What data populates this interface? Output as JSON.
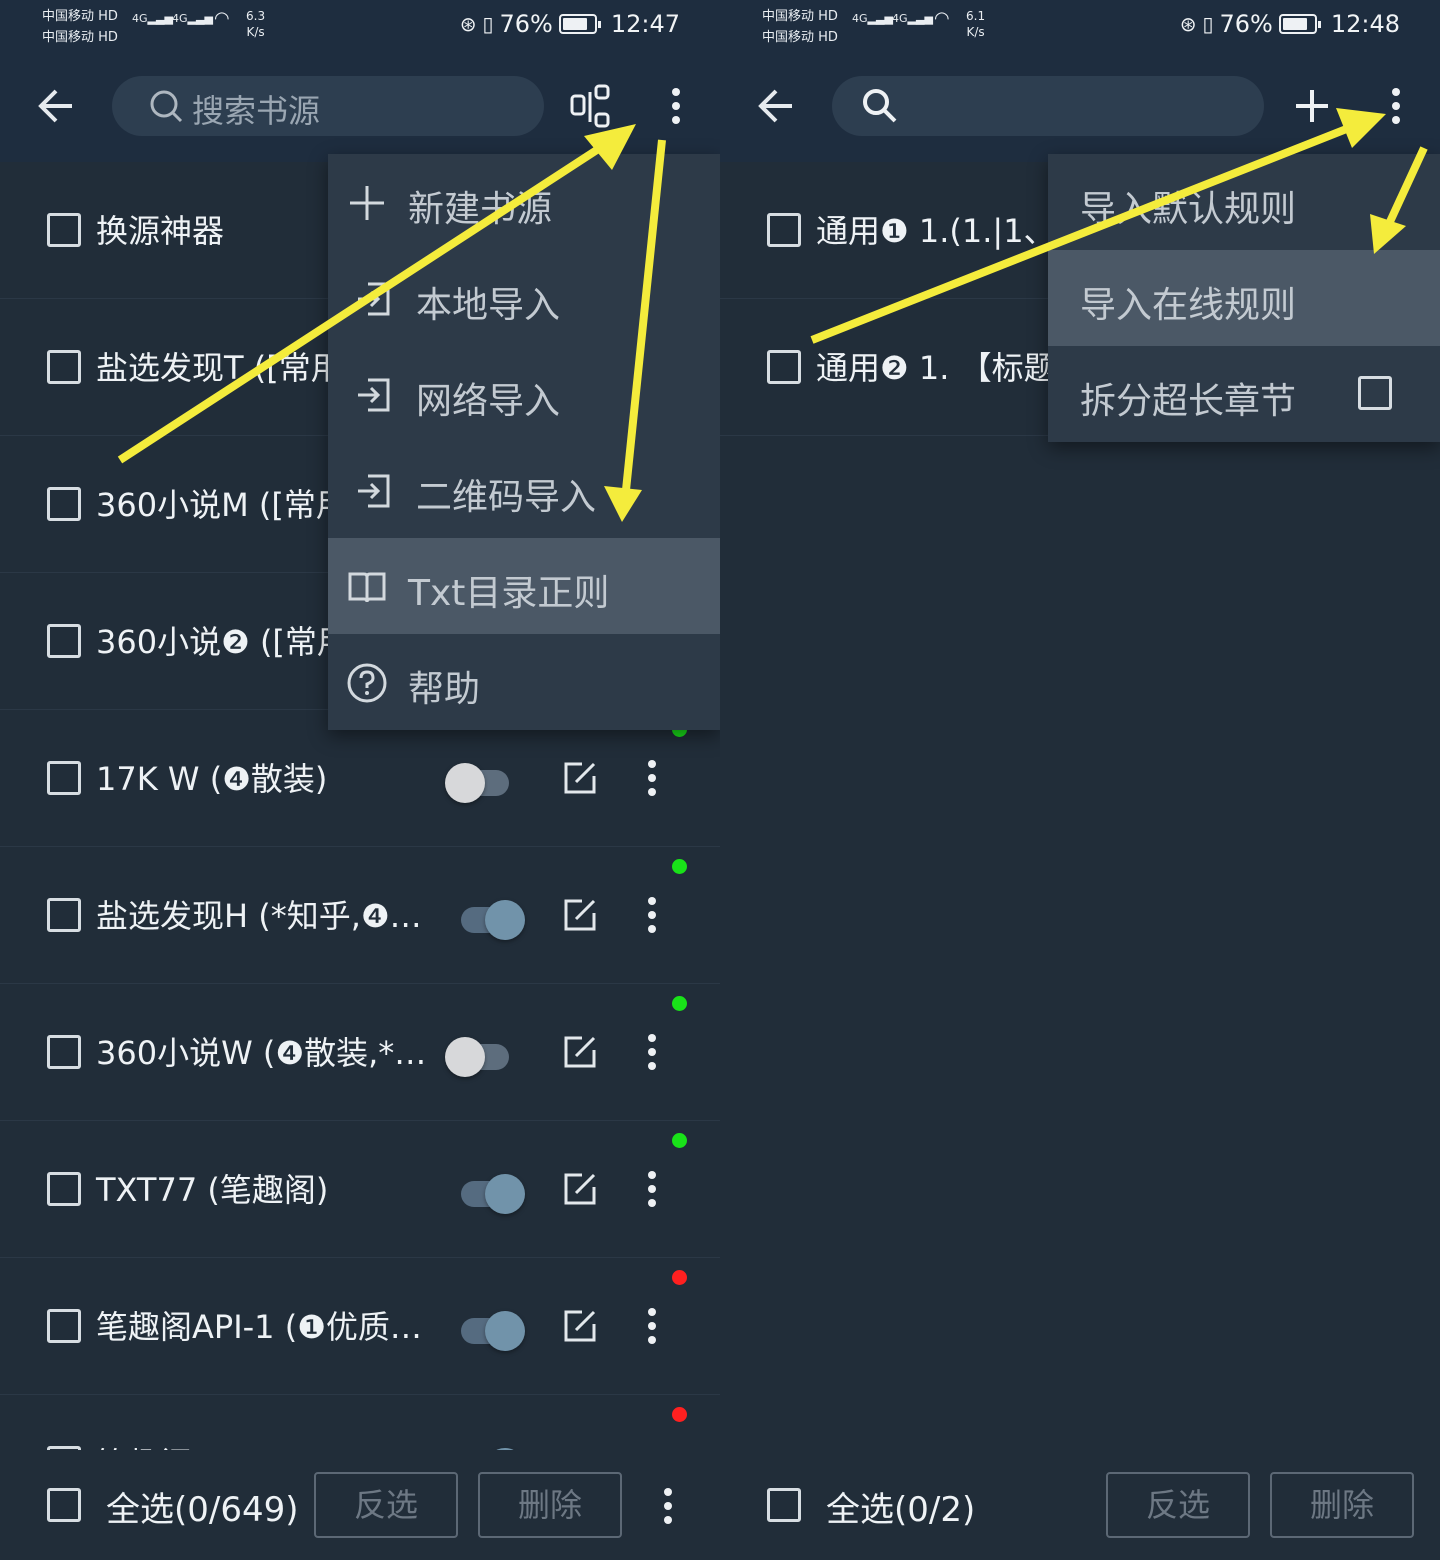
{
  "colors": {
    "arrow": "#f4ec3c",
    "dot_green": "#19e219",
    "dot_red": "#ff2020",
    "toolbar": "#1e2d3f",
    "background": "#212d39"
  },
  "left": {
    "status": {
      "carrier1": "中国移动",
      "carrier2": "中国移动",
      "hd": "HD",
      "net": "4G",
      "speed_value": "6.3",
      "speed_unit": "K/s",
      "battery": "76%",
      "time": "12:47"
    },
    "search_placeholder": "搜索书源",
    "toolbar_icons": [
      "back-arrow-icon",
      "search-icon",
      "qr-scan-icon",
      "more-vert-icon"
    ],
    "rows": [
      {
        "title": "换源神器"
      },
      {
        "title": "盐选发现T ([常用"
      },
      {
        "title": "360小说M ([常用"
      },
      {
        "title": "360小说❷ ([常用"
      },
      {
        "title": "17K W (❹散装)",
        "enabled": false,
        "status": "green"
      },
      {
        "title": "盐选发现H (*知乎,❹…",
        "enabled": true,
        "status": "green"
      },
      {
        "title": "360小说W (❹散装,*…",
        "enabled": false,
        "status": "green"
      },
      {
        "title": "TXT77 (笔趣阁)",
        "enabled": true,
        "status": "green"
      },
      {
        "title": "笔趣阁API-1 (❶优质…",
        "enabled": true,
        "status": "red"
      },
      {
        "title": "笔趣阁…",
        "enabled": true,
        "status": "red"
      }
    ],
    "menu": [
      {
        "label": "新建书源",
        "icon": "plus-icon"
      },
      {
        "label": "本地导入",
        "icon": "import-icon"
      },
      {
        "label": "网络导入",
        "icon": "import-icon"
      },
      {
        "label": "二维码导入",
        "icon": "import-icon"
      },
      {
        "label": "Txt目录正则",
        "icon": "book-icon",
        "selected": true
      },
      {
        "label": "帮助",
        "icon": "help-icon"
      }
    ],
    "bottom": {
      "select_all": "全选(0/649)",
      "invert": "反选",
      "delete": "删除"
    }
  },
  "right": {
    "status": {
      "carrier1": "中国移动",
      "carrier2": "中国移动",
      "hd": "HD",
      "net": "4G",
      "speed_value": "6.1",
      "speed_unit": "K/s",
      "battery": "76%",
      "time": "12:48"
    },
    "toolbar_icons": [
      "back-arrow-icon",
      "search-icon",
      "add-icon",
      "more-vert-icon"
    ],
    "rows": [
      {
        "title": "通用❶ 1.(1.|1、"
      },
      {
        "title": "通用❷ 1. 【标题"
      }
    ],
    "menu": [
      {
        "label": "导入默认规则"
      },
      {
        "label": "导入在线规则",
        "selected": true
      },
      {
        "label": "拆分超长章节",
        "checkbox": false
      }
    ],
    "bottom": {
      "select_all": "全选(0/2)",
      "invert": "反选",
      "delete": "删除"
    }
  }
}
